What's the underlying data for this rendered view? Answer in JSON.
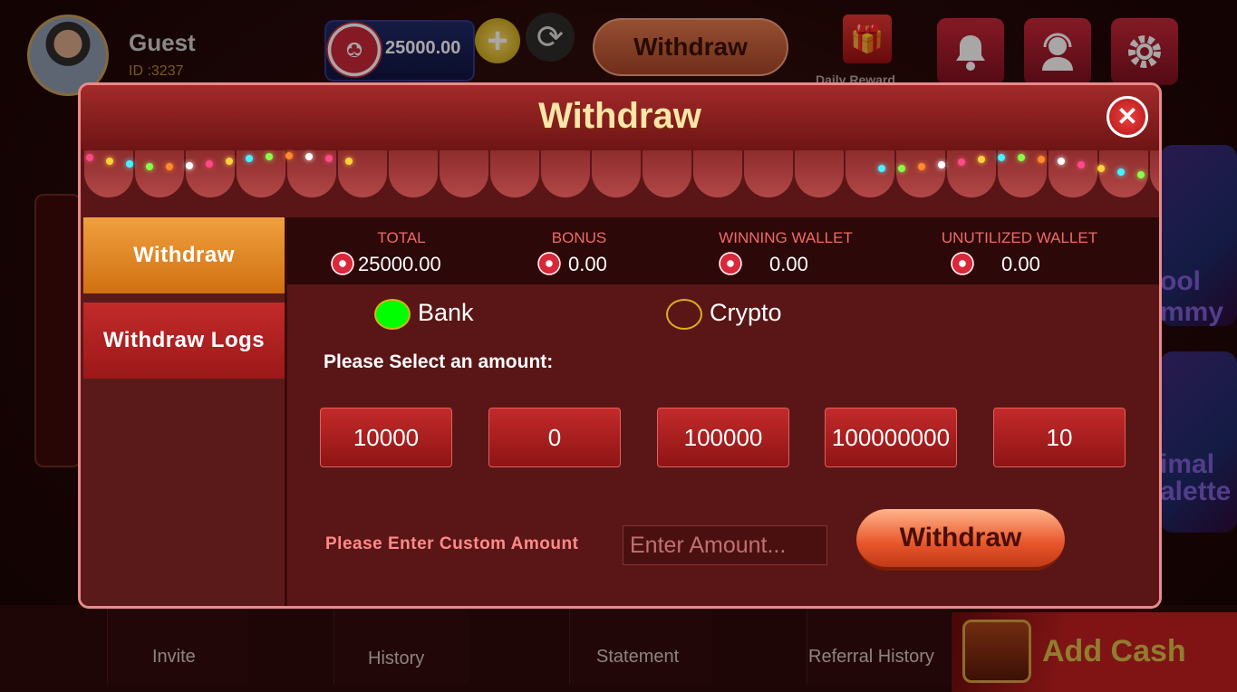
{
  "lobby": {
    "user": {
      "name": "Guest",
      "id": "ID :3237"
    },
    "balance": "25000.00",
    "plus_symbol": "+",
    "refresh_symbol": "⟳",
    "withdraw_button": "Withdraw",
    "daily_reward": "Daily Reward",
    "game_labels": [
      "ool",
      "mmy",
      "imal",
      "alette"
    ],
    "bottom_nav": [
      "Invite",
      "History",
      "Statement",
      "Referral History"
    ],
    "add_cash": "Add Cash"
  },
  "modal": {
    "title": "Withdraw",
    "close_symbol": "✕",
    "tabs": [
      {
        "label": "Withdraw",
        "active": true
      },
      {
        "label": "Withdraw Logs",
        "active": false
      }
    ],
    "wallets": [
      {
        "label": "TOTAL",
        "value": "25000.00"
      },
      {
        "label": "BONUS",
        "value": "0.00"
      },
      {
        "label": "WINNING WALLET",
        "value": "0.00"
      },
      {
        "label": "UNUTILIZED WALLET",
        "value": "0.00"
      }
    ],
    "methods": [
      {
        "label": "Bank",
        "selected": true
      },
      {
        "label": "Crypto",
        "selected": false
      }
    ],
    "select_amount_label": "Please Select an amount:",
    "amounts": [
      "10000",
      "0",
      "100000",
      "100000000",
      "10"
    ],
    "custom_amount_label": "Please Enter Custom Amount",
    "custom_amount_placeholder": "Enter Amount...",
    "custom_amount_value": "",
    "submit_label": "Withdraw"
  },
  "colors": {
    "accent_gold": "#fde6a8",
    "active_tab": "#e88a2a",
    "wallet_label": "#f06a6a",
    "radio_selected": "#00ff00"
  }
}
